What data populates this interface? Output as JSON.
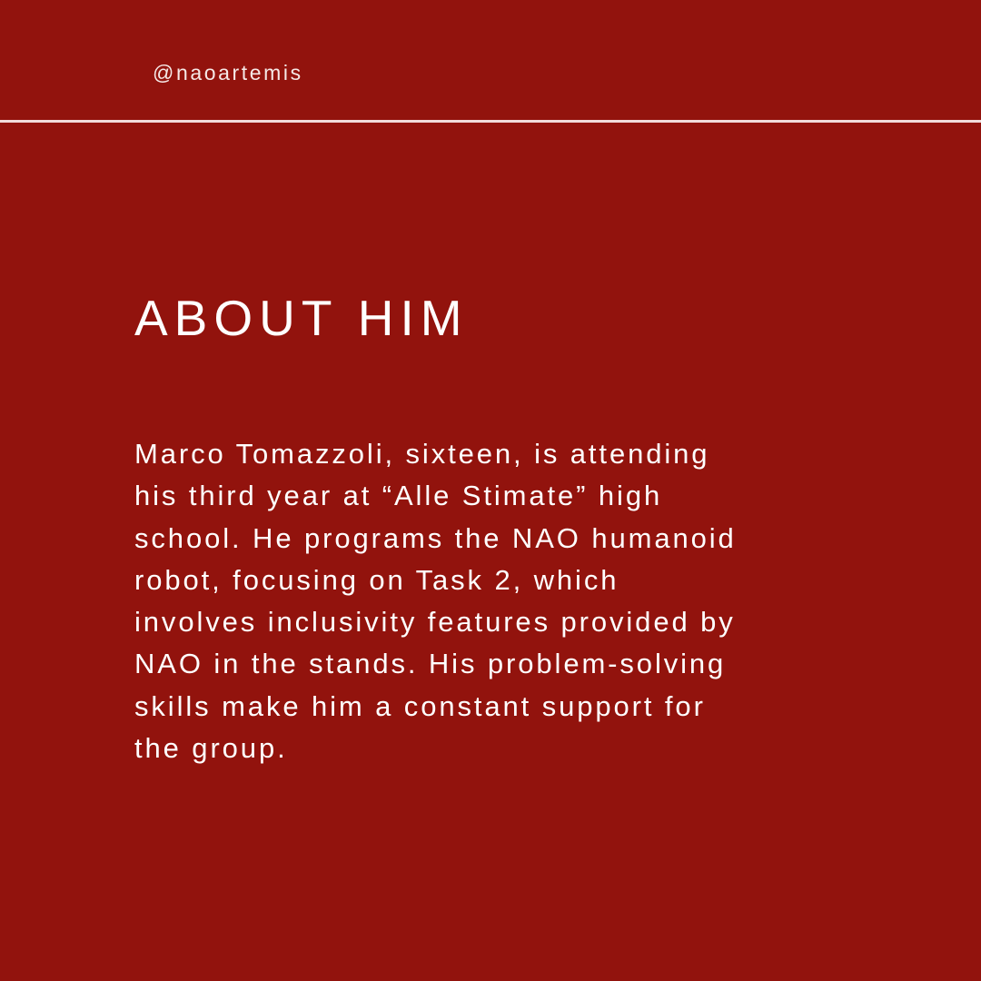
{
  "header": {
    "handle": "@naoartemis"
  },
  "main": {
    "title": "ABOUT HIM",
    "body_lines": [
      "Marco Tomazzoli, sixteen, is attending",
      "his third year at “Alle Stimate” high",
      "school. He programs the NAO humanoid",
      "robot, focusing on Task 2, which",
      "involves inclusivity features provided by",
      "NAO in the stands. His problem-solving",
      "skills make him a constant support for",
      "the group."
    ]
  },
  "colors": {
    "background": "#92130d",
    "text": "#ffffff",
    "divider": "#f2dcda"
  }
}
